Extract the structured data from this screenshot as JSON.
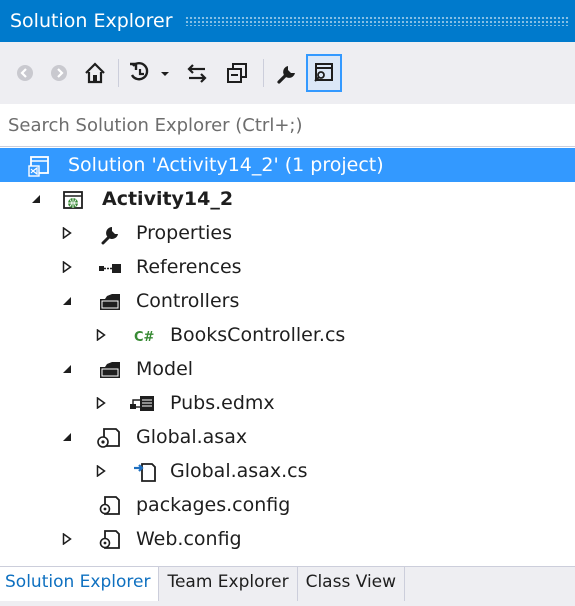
{
  "window": {
    "title": "Solution Explorer"
  },
  "toolbar": {
    "buttons": [
      "back-icon",
      "forward-icon",
      "home-icon",
      "pending-changes-icon",
      "sync-icon",
      "collapse-all-icon",
      "properties-icon",
      "preview-icon"
    ]
  },
  "search": {
    "placeholder": "Search Solution Explorer (Ctrl+;)"
  },
  "tree": {
    "solution": "Solution 'Activity14_2' (1 project)",
    "project": "Activity14_2",
    "properties": "Properties",
    "references": "References",
    "controllers": "Controllers",
    "books_controller": "BooksController.cs",
    "model": "Model",
    "pubs_edmx": "Pubs.edmx",
    "global_asax": "Global.asax",
    "global_asax_cs": "Global.asax.cs",
    "packages_config": "packages.config",
    "web_config": "Web.config"
  },
  "tabs": [
    "Solution Explorer",
    "Team Explorer",
    "Class View"
  ],
  "colors": {
    "accent": "#007acc",
    "selection": "#3399ff",
    "csharp": "#388a34"
  }
}
